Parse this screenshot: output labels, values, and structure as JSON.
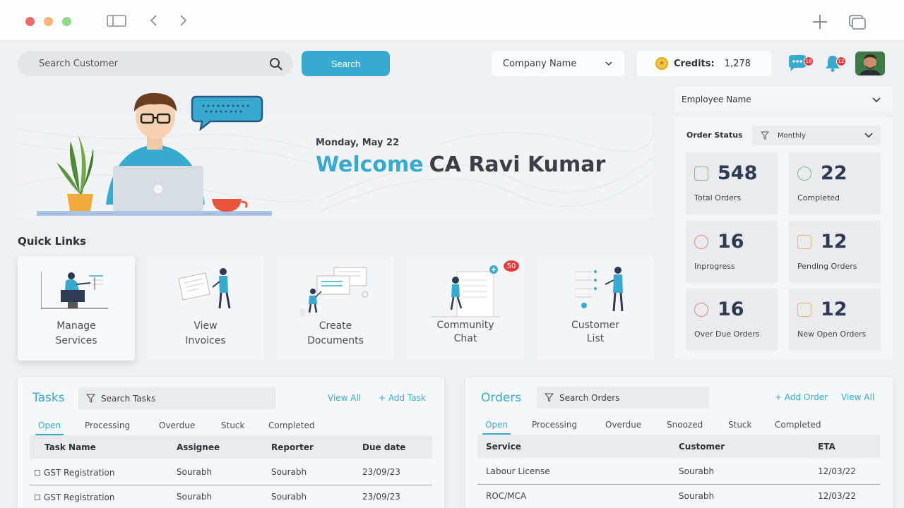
{
  "search": {
    "placeholder": "Search Customer",
    "button": "Search"
  },
  "company": {
    "label": "Company Name"
  },
  "credits": {
    "label": "Credits:",
    "value": "1,278"
  },
  "notifications": {
    "chat_count": "18",
    "bell_count": "12"
  },
  "hero": {
    "date": "Monday, May 22",
    "welcome": "Welcome",
    "name": "CA Ravi Kumar"
  },
  "quick_links": {
    "title": "Quick Links",
    "items": [
      {
        "line1": "Manage",
        "line2": "Services"
      },
      {
        "line1": "View",
        "line2": "Invoices"
      },
      {
        "line1": "Create",
        "line2": "Documents"
      },
      {
        "line1": "Community",
        "line2": "Chat",
        "badge": "50"
      },
      {
        "line1": "Customer",
        "line2": "List"
      }
    ]
  },
  "employee": {
    "label": "Employee Name"
  },
  "order_status": {
    "title": "Order Status",
    "period": "Monthly",
    "stats": [
      {
        "value": "548",
        "caption": "Total Orders"
      },
      {
        "value": "22",
        "caption": "Completed"
      },
      {
        "value": "16",
        "caption": "Inprogress"
      },
      {
        "value": "12",
        "caption": "Pending Orders"
      },
      {
        "value": "16",
        "caption": "Over Due Orders"
      },
      {
        "value": "12",
        "caption": "New Open Orders"
      }
    ]
  },
  "tasks": {
    "title": "Tasks",
    "search_placeholder": "Search Tasks",
    "view_all": "View All",
    "add": "+ Add Task",
    "tabs": [
      "Open",
      "Processing",
      "Overdue",
      "Stuck",
      "Completed"
    ],
    "columns": [
      "Task Name",
      "Assignee",
      "Reporter",
      "Due date"
    ],
    "rows": [
      [
        "GST Registration",
        "Sourabh",
        "Sourabh",
        "23/09/23"
      ],
      [
        "GST Registration",
        "Sourabh",
        "Sourabh",
        "23/09/23"
      ]
    ]
  },
  "orders": {
    "title": "Orders",
    "search_placeholder": "Search Orders",
    "add": "+ Add Order",
    "view_all": "View All",
    "tabs": [
      "Open",
      "Processing",
      "Overdue",
      "Snoozed",
      "Stuck",
      "Completed"
    ],
    "columns": [
      "Service",
      "Customer",
      "ETA"
    ],
    "rows": [
      [
        "Labour License",
        "Sourabh",
        "12/03/22"
      ],
      [
        "ROC/MCA",
        "Sourabh",
        "12/03/22"
      ]
    ]
  },
  "colors": {
    "accent": "#38a9cf",
    "badge": "#e43c3c"
  }
}
